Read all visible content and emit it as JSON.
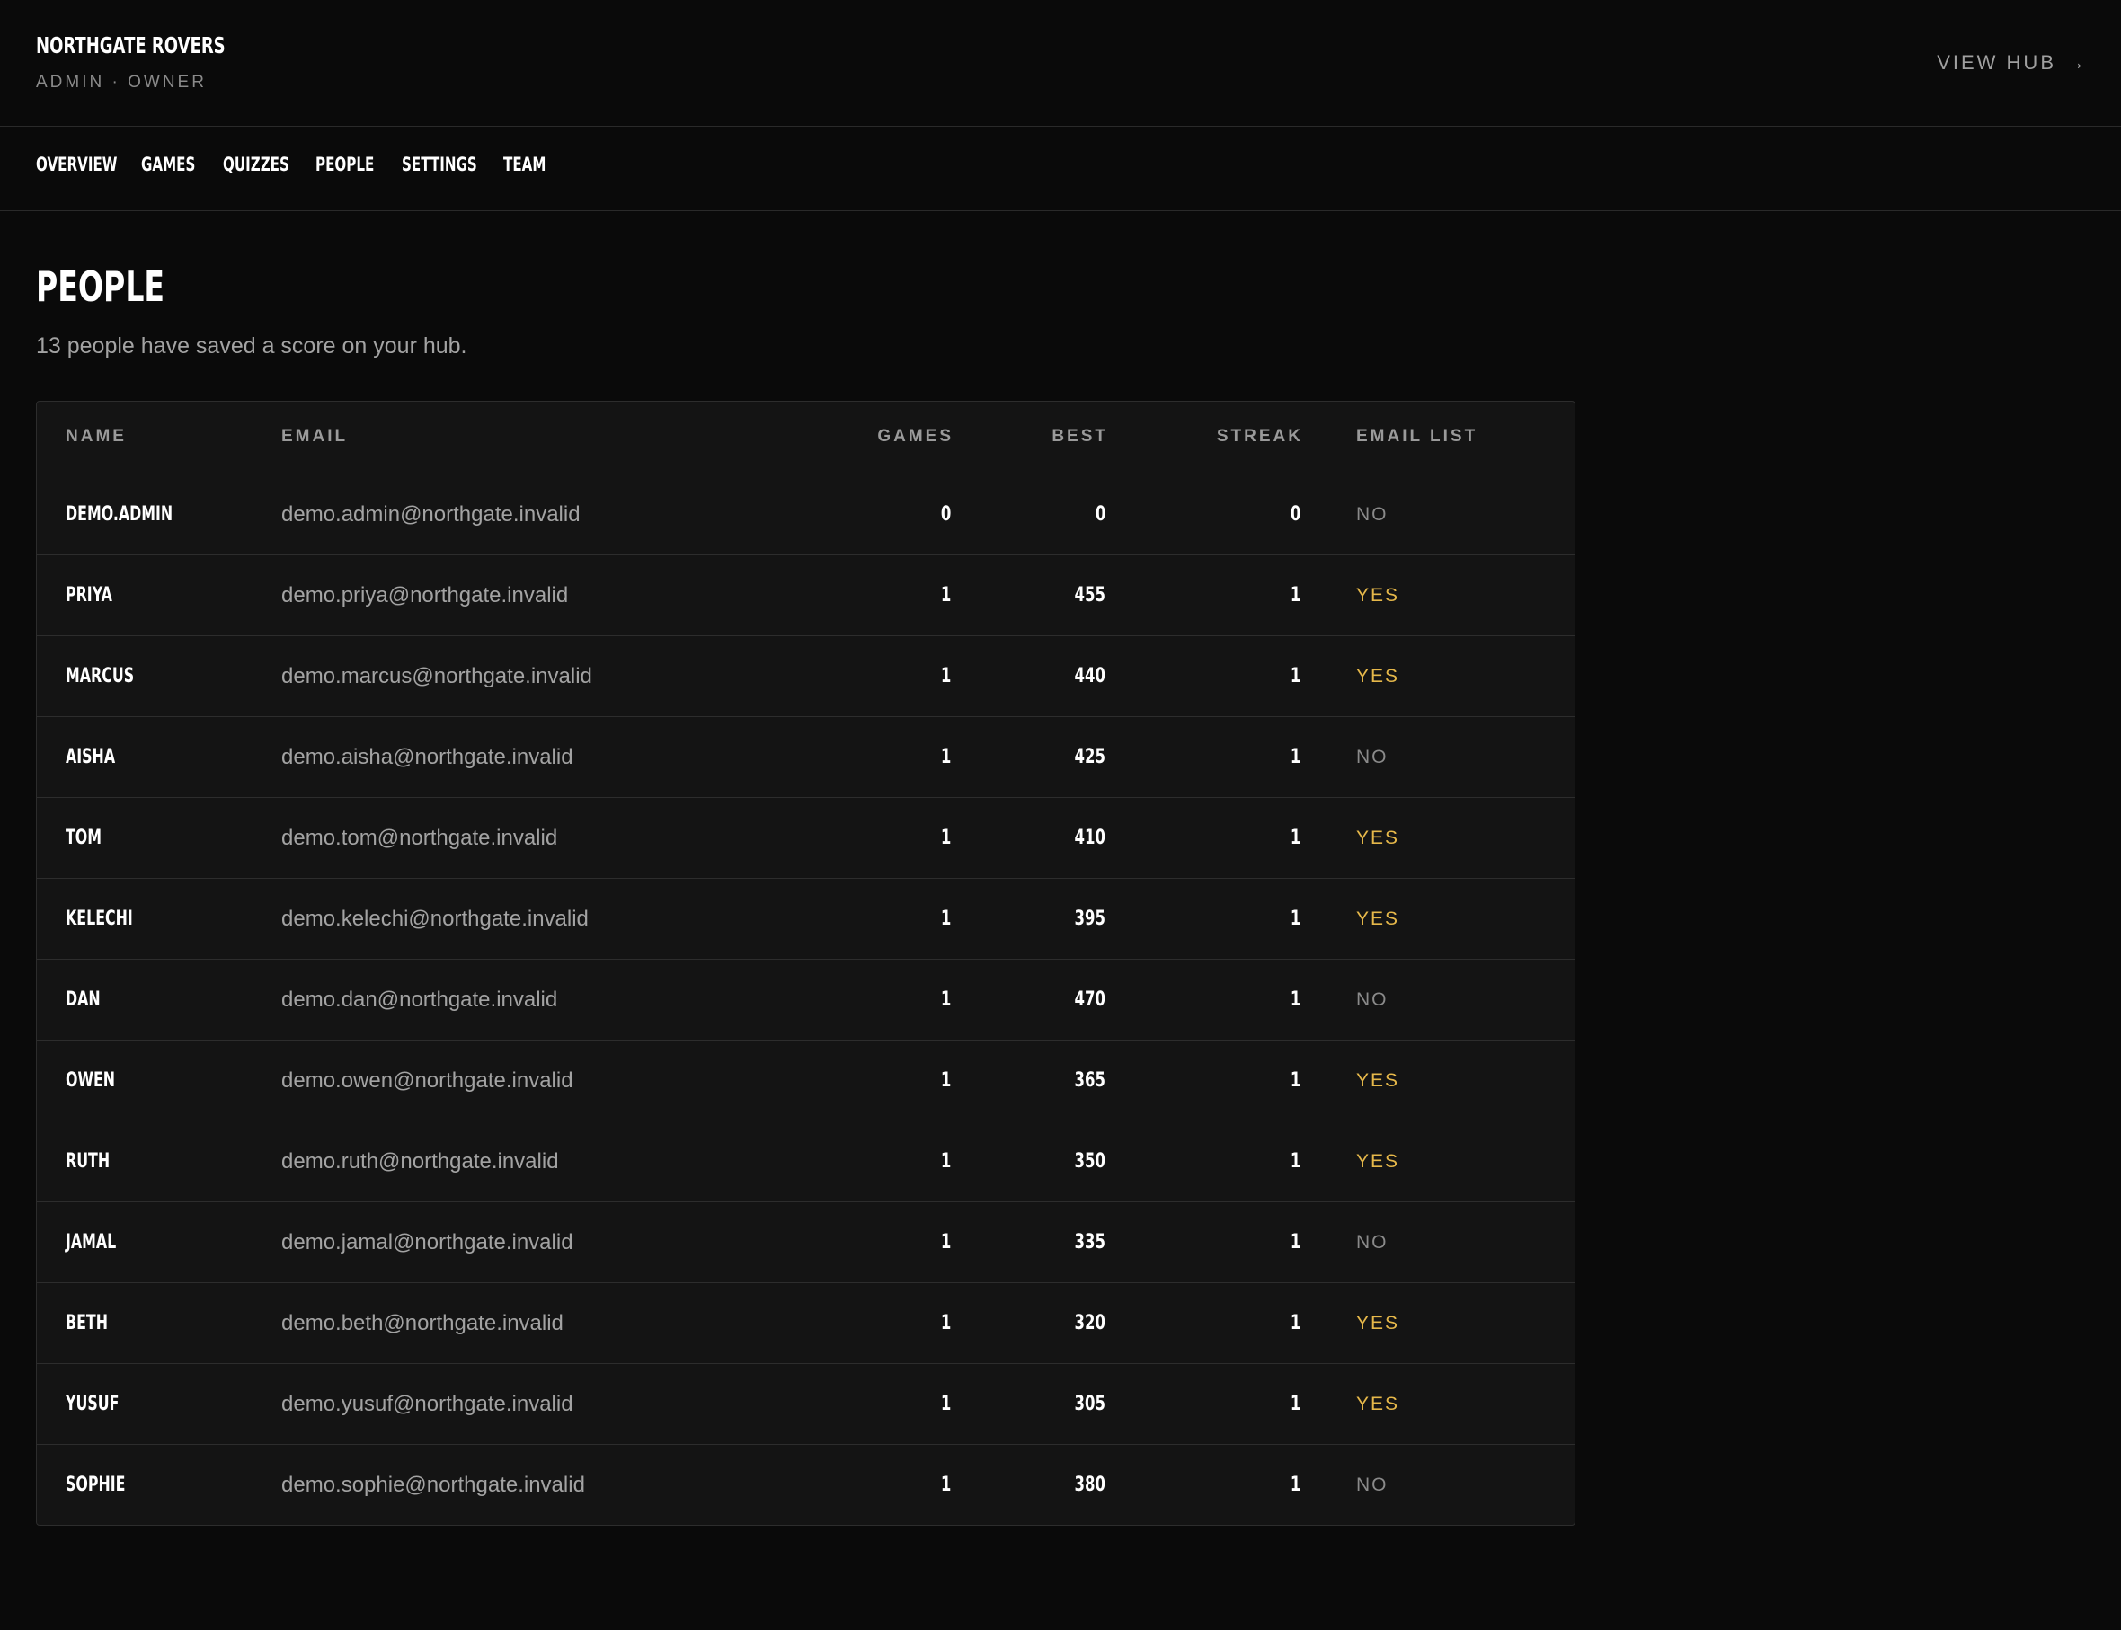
{
  "header": {
    "team_name": "NORTHGATE ROVERS",
    "role": "ADMIN · OWNER",
    "view_hub_label": "VIEW HUB",
    "view_hub_arrow": "→"
  },
  "nav": {
    "tabs": [
      "OVERVIEW",
      "GAMES",
      "QUIZZES",
      "PEOPLE",
      "SETTINGS",
      "TEAM"
    ]
  },
  "main": {
    "title": "PEOPLE",
    "subtitle": "13 people have saved a score on your hub."
  },
  "table": {
    "columns": {
      "name": "NAME",
      "email": "EMAIL",
      "games": "GAMES",
      "best": "BEST",
      "streak": "STREAK",
      "email_list": "EMAIL LIST"
    },
    "rows": [
      {
        "name": "DEMO.ADMIN",
        "email": "demo.admin@northgate.invalid",
        "games": "0",
        "best": "0",
        "streak": "0",
        "email_list": "NO"
      },
      {
        "name": "PRIYA",
        "email": "demo.priya@northgate.invalid",
        "games": "1",
        "best": "455",
        "streak": "1",
        "email_list": "YES"
      },
      {
        "name": "MARCUS",
        "email": "demo.marcus@northgate.invalid",
        "games": "1",
        "best": "440",
        "streak": "1",
        "email_list": "YES"
      },
      {
        "name": "AISHA",
        "email": "demo.aisha@northgate.invalid",
        "games": "1",
        "best": "425",
        "streak": "1",
        "email_list": "NO"
      },
      {
        "name": "TOM",
        "email": "demo.tom@northgate.invalid",
        "games": "1",
        "best": "410",
        "streak": "1",
        "email_list": "YES"
      },
      {
        "name": "KELECHI",
        "email": "demo.kelechi@northgate.invalid",
        "games": "1",
        "best": "395",
        "streak": "1",
        "email_list": "YES"
      },
      {
        "name": "DAN",
        "email": "demo.dan@northgate.invalid",
        "games": "1",
        "best": "470",
        "streak": "1",
        "email_list": "NO"
      },
      {
        "name": "OWEN",
        "email": "demo.owen@northgate.invalid",
        "games": "1",
        "best": "365",
        "streak": "1",
        "email_list": "YES"
      },
      {
        "name": "RUTH",
        "email": "demo.ruth@northgate.invalid",
        "games": "1",
        "best": "350",
        "streak": "1",
        "email_list": "YES"
      },
      {
        "name": "JAMAL",
        "email": "demo.jamal@northgate.invalid",
        "games": "1",
        "best": "335",
        "streak": "1",
        "email_list": "NO"
      },
      {
        "name": "BETH",
        "email": "demo.beth@northgate.invalid",
        "games": "1",
        "best": "320",
        "streak": "1",
        "email_list": "YES"
      },
      {
        "name": "YUSUF",
        "email": "demo.yusuf@northgate.invalid",
        "games": "1",
        "best": "305",
        "streak": "1",
        "email_list": "YES"
      },
      {
        "name": "SOPHIE",
        "email": "demo.sophie@northgate.invalid",
        "games": "1",
        "best": "380",
        "streak": "1",
        "email_list": "NO"
      }
    ]
  },
  "colors": {
    "background": "#0a0a0a",
    "table_background": "#141414",
    "accent_yes": "#e6b84a",
    "muted_no": "#8a8a8a"
  }
}
